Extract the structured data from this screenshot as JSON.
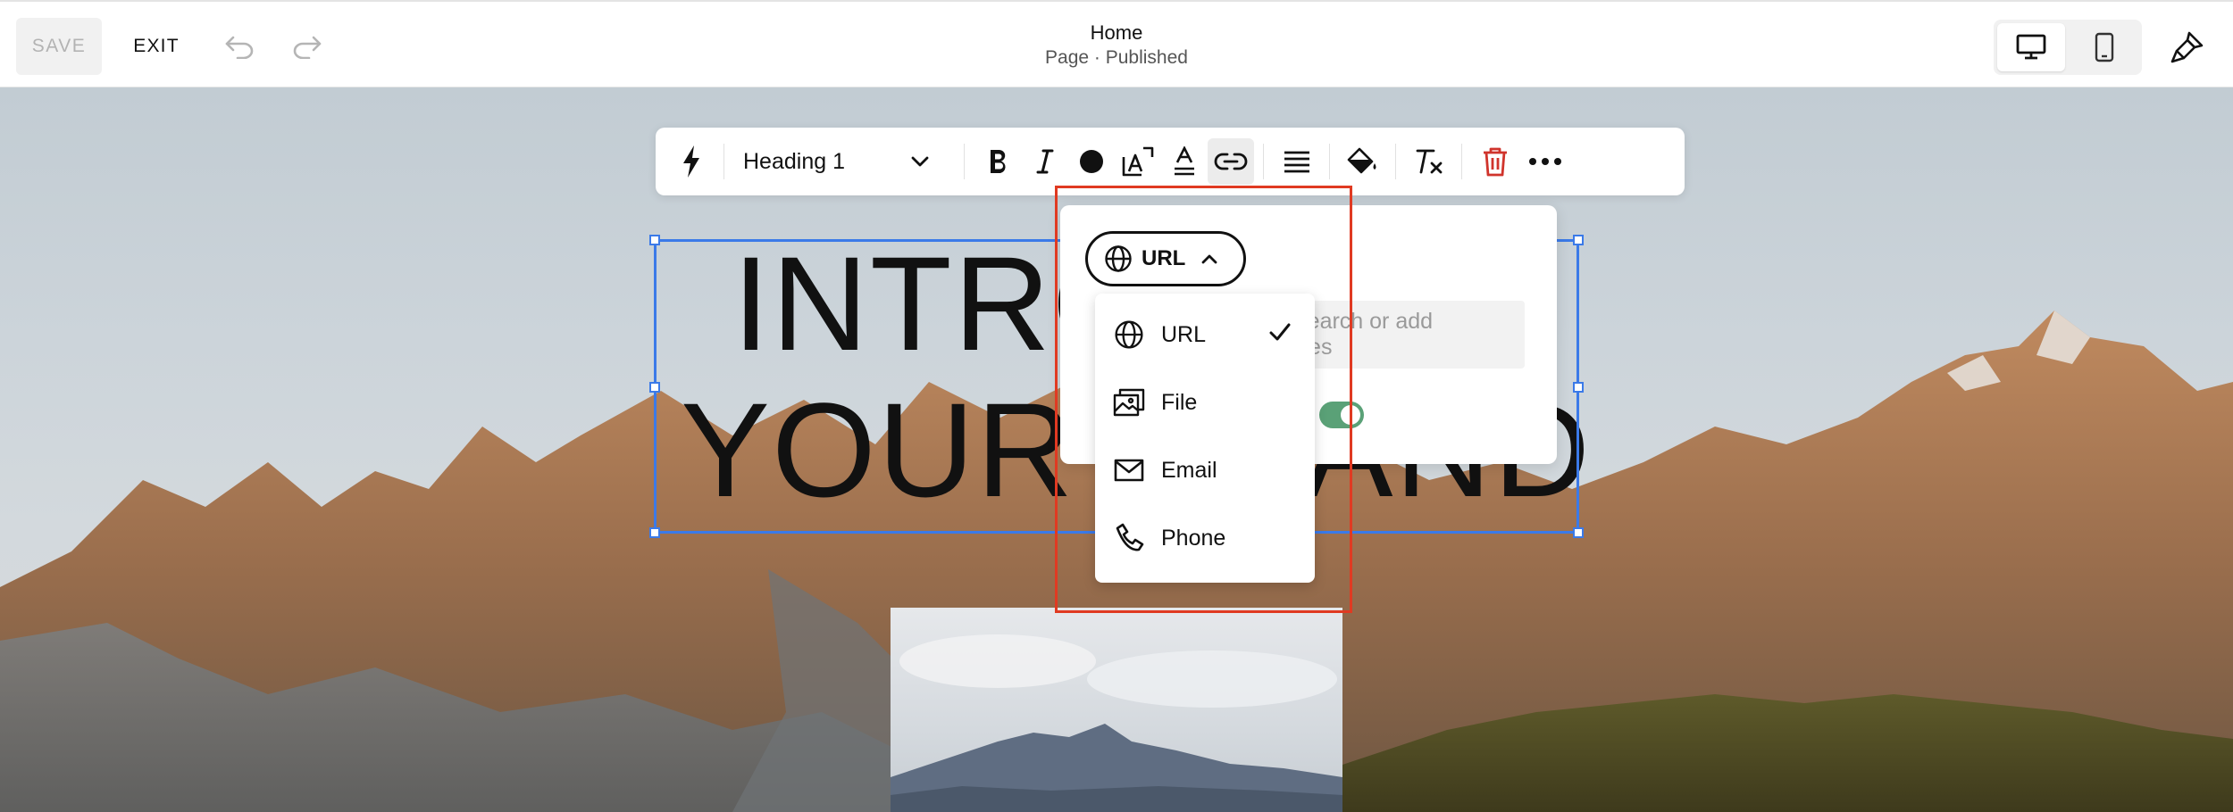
{
  "topbar": {
    "save_label": "SAVE",
    "exit_label": "EXIT",
    "page_title": "Home",
    "page_status": "Page · Published"
  },
  "toolbar": {
    "text_style": "Heading 1",
    "active_tool": "link"
  },
  "heading": {
    "line1": "INTRO",
    "line2": "YOUR BRAND"
  },
  "link_panel": {
    "type_label": "URL",
    "input_placeholder": "Search or add files",
    "toggle_on": true
  },
  "link_type_menu": {
    "items": [
      {
        "label": "URL",
        "icon": "globe-icon",
        "selected": true
      },
      {
        "label": "File",
        "icon": "file-image-icon",
        "selected": false
      },
      {
        "label": "Email",
        "icon": "mail-icon",
        "selected": false
      },
      {
        "label": "Phone",
        "icon": "phone-icon",
        "selected": false
      }
    ]
  },
  "colors": {
    "selection_blue": "#3b7ae8",
    "highlight_red": "#e03a22",
    "toggle_green": "#5aa177",
    "delete_red": "#d0342c"
  }
}
